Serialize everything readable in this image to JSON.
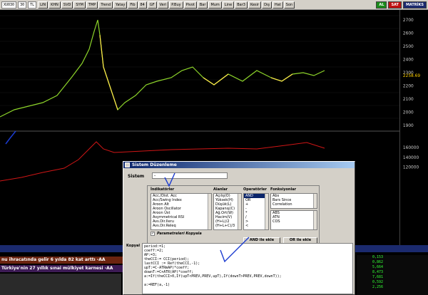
{
  "toolbar": {
    "symbol": "XU030",
    "period": "30",
    "currency": "TL",
    "buttons": [
      "LIN",
      "KHN",
      "SVD",
      "SYM",
      "TMP",
      "Trend",
      "Yatay",
      "Fib",
      "84",
      "GF",
      "Veri",
      "P.Buy",
      "Pivot",
      "Bar",
      "Mum",
      "Line",
      "Bar3",
      "Kesir",
      "Dış",
      "Hat",
      "Son"
    ],
    "al_label": "AL",
    "sat_label": "SAT",
    "matriks_label": "MATRİKS"
  },
  "chart": {
    "price_ticks": [
      "2700",
      "2600",
      "2500",
      "2400",
      "2300",
      "2200",
      "2100",
      "2000",
      "1900"
    ],
    "current_price": "2258.69",
    "volume_ticks": [
      "160000",
      "140000",
      "120000"
    ],
    "price_color": "#8dd42a",
    "signal_color": "#ffe94a",
    "volume_color": "#d01616"
  },
  "news": {
    "line1": "nu ihracatında gelir 6 yılda 82 kat arttı -AA",
    "line2": "Türkiye'nin 27 yıllık sınai mülkiyet karnesi -AA"
  },
  "dialog": {
    "title": "Sistem Düzenleme",
    "sistem_label": "Sistem",
    "sistem_value": "-",
    "headers": {
      "indicators": "İndikatörler",
      "fields": "Alanlar",
      "operators": "Operatörler",
      "functions": "Fonksiyonlar"
    },
    "indicators": [
      "Acc./Dist. Acc",
      "Acc/Swing Index",
      "Aroon Alt",
      "Aroon Oscillator",
      "Aroon Üst",
      "Asymmetrical RSI",
      "Avs.Dir.Ileru",
      "Avs.Dir.Releq"
    ],
    "fields": [
      "Açılış(O)",
      "Yüksek(H)",
      "Düşük(L)",
      "Kapanış(C)",
      "Ağ.Ort(W)",
      "Hacim(V)",
      "(H+L)/2",
      "(H+L+C)/3"
    ],
    "operators": [
      "AND",
      "OR",
      "+",
      "-",
      "*",
      "/",
      ">",
      "<"
    ],
    "functions": [
      "Abs",
      "Bars Since",
      "Correlation"
    ],
    "functions_2": [
      "ABS",
      "ATN",
      "COS"
    ],
    "checkbox_label": "Parametreleri Kopyala",
    "checkbox_mark": "✓",
    "and_button": "AND ile ekle",
    "or_button": "OR ile ekle",
    "kopyala_label": "Kopyal",
    "code_lines": [
      "period:=1;",
      "coeff:=2;",
      "AP:=3;",
      "theCCI:= CCI(period);",
      "lastCCI := Ref(theCCI,-1);",
      "upT:=C-ATRmAP)*coeff;",
      "downT:=C+ATR(AP)*coeff;",
      "a:=If(theCCI>0,If(upT<PREV,PREV,upT),If(downT>PREV,PREV,downT));",
      "",
      "a:=REF(a,-1)"
    ]
  },
  "right_list": {
    "rows": [
      "0,153",
      "0,862",
      "5,664",
      "8,473",
      "7,681",
      "0,592",
      "2,256"
    ]
  }
}
